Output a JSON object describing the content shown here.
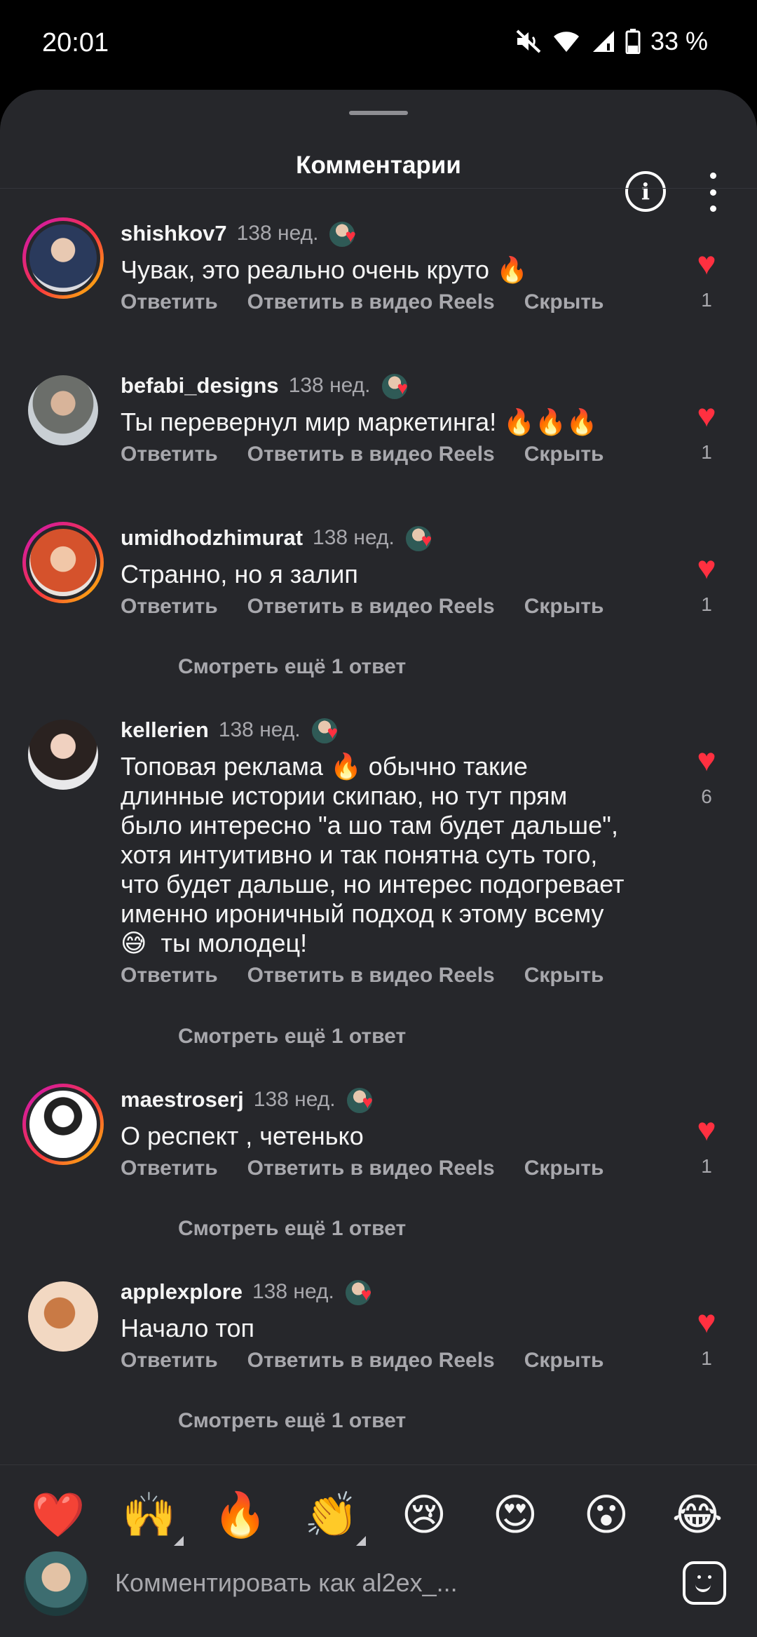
{
  "status": {
    "time": "20:01",
    "battery": "33 %"
  },
  "header": {
    "title": "Комментарии"
  },
  "actions": {
    "reply": "Ответить",
    "reply_reels": "Ответить в видео Reels",
    "hide": "Скрыть"
  },
  "comments": [
    {
      "username": "shishkov7",
      "time": "138 нед.",
      "text": "Чувак, это реально очень круто 🔥",
      "likes": "1",
      "story_ring": true
    },
    {
      "username": "befabi_designs",
      "time": "138 нед.",
      "text": "Ты перевернул мир маркетинга! 🔥🔥🔥",
      "likes": "1",
      "story_ring": false
    },
    {
      "username": "umidhodzhimurat",
      "time": "138 нед.",
      "text": "Странно, но я залип",
      "likes": "1",
      "story_ring": true,
      "more": "Смотреть ещё 1 ответ"
    },
    {
      "username": "kellerien",
      "time": "138 нед.",
      "text": "Топовая реклама 🔥 обычно такие\nдлинные истории скипаю, но тут прям\nбыло интересно \"а шо там будет дальше\",\nхотя интуитивно и так понятна суть того,\nчто будет дальше, но интерес подогревает\nименно ироничный подход к этому всему\n😅  ты молодец!",
      "likes": "6",
      "story_ring": false,
      "more": "Смотреть ещё 1 ответ"
    },
    {
      "username": "maestroserj",
      "time": "138 нед.",
      "text": "О респект , четенько",
      "likes": "1",
      "story_ring": true,
      "more": "Смотреть ещё 1 ответ"
    },
    {
      "username": "applexplore",
      "time": "138 нед.",
      "text": "Начало топ",
      "likes": "1",
      "story_ring": false,
      "more": "Смотреть ещё 1 ответ"
    }
  ],
  "reactions": [
    "❤️",
    "🙌",
    "🔥",
    "👏",
    "😢",
    "😍",
    "😮",
    "😂"
  ],
  "composer": {
    "placeholder": "Комментировать как al2ex_..."
  },
  "icons": {
    "mute": "mute-icon",
    "wifi": "wifi-icon",
    "signal": "signal-icon",
    "battery": "battery-icon",
    "info": "info-icon",
    "more": "more-vertical-icon",
    "heart": "heart-icon",
    "sticker": "sticker-icon"
  },
  "colors": {
    "background": "#26272b",
    "like": "#ff3040",
    "muted_text": "#a8a8ad"
  }
}
